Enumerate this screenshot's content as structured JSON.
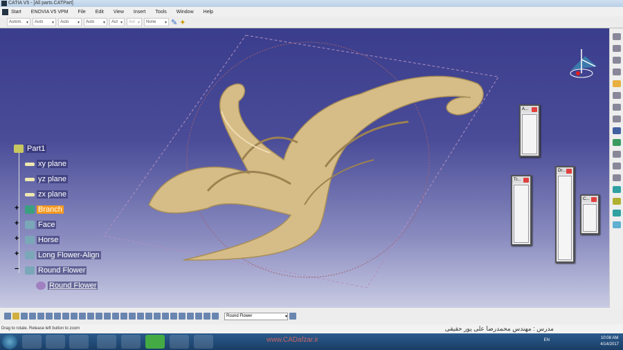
{
  "window": {
    "title": "CATIA V5 - [All parts.CATPart]"
  },
  "menubar": [
    "Start",
    "ENOVIA V5 VPM",
    "File",
    "Edit",
    "View",
    "Insert",
    "Tools",
    "Window",
    "Help"
  ],
  "toolbar": {
    "dropdowns": [
      "Autom.",
      "Auto",
      "Auto",
      "Auto",
      "Aut",
      "Aut",
      "None"
    ]
  },
  "tree": {
    "root": "Part1",
    "items": [
      {
        "label": "xy plane",
        "icon": "plane-icon"
      },
      {
        "label": "yz plane",
        "icon": "plane-icon"
      },
      {
        "label": "zx plane",
        "icon": "plane-icon"
      },
      {
        "label": "Branch",
        "icon": "body-icon",
        "selected": true
      },
      {
        "label": "Face",
        "icon": "body-icon"
      },
      {
        "label": "Horse",
        "icon": "body-icon"
      },
      {
        "label": "Long Flower-Align",
        "icon": "body-icon"
      },
      {
        "label": "Round Flower",
        "icon": "body-icon",
        "expanded": true
      },
      {
        "label": "Round Flower",
        "icon": "surface-icon",
        "child": true
      }
    ]
  },
  "palettes": [
    {
      "title": "A..."
    },
    {
      "title": "Tr..."
    },
    {
      "title": "Dr..."
    },
    {
      "title": "C..."
    }
  ],
  "bottom_toolbar": {
    "current_selection": "Round Flower"
  },
  "status": {
    "message": "Drag to rotate. Release left button to zoom",
    "instructor": "مدرس : مهندس محمدرضا علی پور حقیقی"
  },
  "taskbar": {
    "watermark": "www.CADafzar.ir",
    "language": "EN",
    "time": "10:08 AM",
    "date": "4/14/2017"
  },
  "colors": {
    "selection": "#f59a20",
    "model": "#d6bc86",
    "viewport_top": "#3a3d8c"
  }
}
